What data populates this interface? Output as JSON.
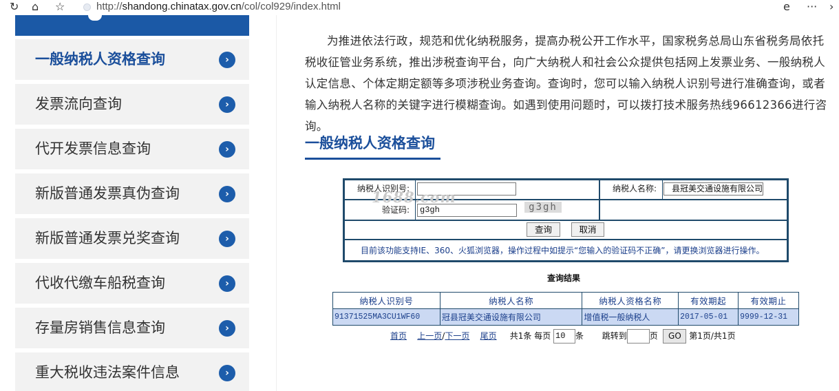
{
  "browser": {
    "url_prefix": "http://",
    "url_host": "shandong.chinatax.gov.cn",
    "url_path": "/col/col929/index.html",
    "icons": [
      "reload-icon",
      "home-icon",
      "favorites-icon",
      "ie-mode-icon",
      "more-icon"
    ]
  },
  "sidebar": {
    "items": [
      {
        "label": "一般纳税人资格查询",
        "active": true
      },
      {
        "label": "发票流向查询"
      },
      {
        "label": "代开发票信息查询"
      },
      {
        "label": "新版普通发票真伪查询"
      },
      {
        "label": "新版普通发票兑奖查询"
      },
      {
        "label": "代收代缴车船税查询"
      },
      {
        "label": "存量房销售信息查询"
      },
      {
        "label": "重大税收违法案件信息"
      }
    ],
    "arrow_glyph": "›",
    "accent": "#1b59a6"
  },
  "main": {
    "intro": "为推进依法行政，规范和优化纳税服务，提高办税公开工作水平，国家税务总局山东省税务局依托税收征管业务系统，推出涉税查询平台，向广大纳税人和社会公众提供包括网上发票业务、一般纳税人认定信息、个体定期定额等多项涉税业务查询。查询时，您可以输入纳税人识别号进行准确查询，或者输入纳税人名称的关键字进行模糊查询。如遇到使用问题时，可以拨打技术服务热线96612366进行咨询。",
    "section_title": "一般纳税人资格查询"
  },
  "form": {
    "taxpayer_id_label": "纳税人识别号:",
    "taxpayer_id_value": "",
    "taxpayer_name_label": "纳税人名称:",
    "taxpayer_name_value": "县冠美交通设施有限公司",
    "captcha_label": "验证码:",
    "captcha_value": "g3gh",
    "captcha_image_text": "g3gh",
    "watermark": "1688.com",
    "query_button": "查询",
    "cancel_button": "取消",
    "notice": "目前该功能支持IE、360、火狐浏览器，操作过程中如提示“您输入的验证码不正确”，请更换浏览器进行操作。"
  },
  "results": {
    "title": "查询结果",
    "columns": [
      "纳税人识别号",
      "纳税人名称",
      "纳税人资格名称",
      "有效期起",
      "有效期止"
    ],
    "rows": [
      [
        "91371525MA3CU1WF60",
        "冠县冠美交通设施有限公司",
        "增值税一般纳税人",
        "2017-05-01",
        "9999-12-31"
      ]
    ],
    "pager": {
      "first": "首页",
      "prev": "上一页",
      "sep": "/",
      "next": "下一页",
      "last": "尾页",
      "total": "共1条",
      "per_page_label": "每页",
      "per_page_value": "10",
      "per_page_unit": "条",
      "jump_label": "跳转到",
      "jump_value": "",
      "page_unit": "页",
      "go_button": "GO",
      "status": "第1页/共1页"
    }
  }
}
